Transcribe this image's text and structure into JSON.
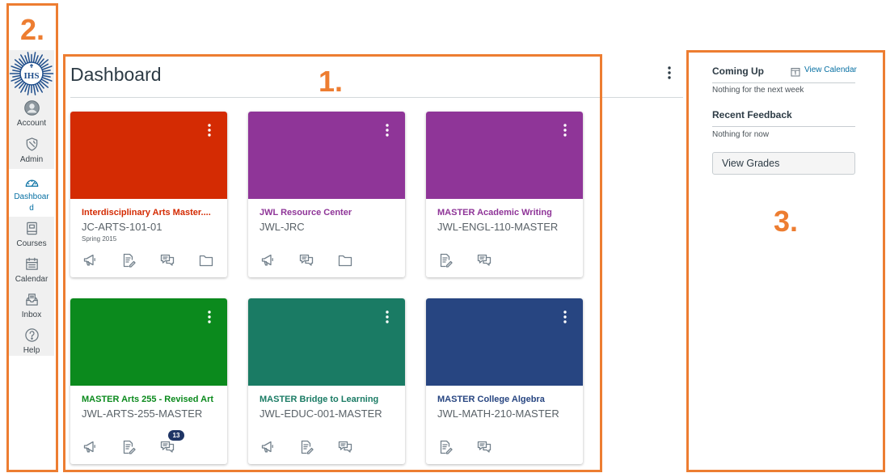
{
  "annotations": {
    "label_1": "1.",
    "label_2": "2.",
    "label_3": "3.",
    "color": "#ed7d31"
  },
  "colors": {
    "link": "#0770a3",
    "text": "#2d3b45",
    "logo": "#1f4e8c",
    "badge": "#1f3565"
  },
  "nav": {
    "logo_text": "IHS",
    "items": [
      {
        "label": "Account",
        "icon": "account-icon"
      },
      {
        "label": "Admin",
        "icon": "admin-icon"
      },
      {
        "label": "Dashboard",
        "icon": "dashboard-icon",
        "active": true
      },
      {
        "label": "Courses",
        "icon": "courses-icon"
      },
      {
        "label": "Calendar",
        "icon": "calendar-icon"
      },
      {
        "label": "Inbox",
        "icon": "inbox-icon"
      },
      {
        "label": "Help",
        "icon": "help-icon"
      }
    ]
  },
  "header": {
    "title": "Dashboard",
    "menu_icon": "more-options-icon"
  },
  "cards": [
    {
      "title": "Interdisciplinary Arts Master....",
      "code": "JC-ARTS-101-01",
      "term": "Spring 2015",
      "color": "#d42b03",
      "icons": [
        {
          "name": "announcements-icon"
        },
        {
          "name": "assignments-icon"
        },
        {
          "name": "discussions-icon"
        },
        {
          "name": "files-icon"
        }
      ]
    },
    {
      "title": "JWL Resource Center",
      "code": "JWL-JRC",
      "color": "#8f3598",
      "icons": [
        {
          "name": "announcements-icon"
        },
        {
          "name": "discussions-icon"
        },
        {
          "name": "files-icon"
        }
      ]
    },
    {
      "title": "MASTER Academic Writing",
      "code": "JWL-ENGL-110-MASTER",
      "color": "#8f3598",
      "icons": [
        {
          "name": "assignments-icon"
        },
        {
          "name": "discussions-icon"
        }
      ]
    },
    {
      "title": "MASTER Arts 255 - Revised Art",
      "code": "JWL-ARTS-255-MASTER",
      "color": "#0b8a1d",
      "icons": [
        {
          "name": "announcements-icon"
        },
        {
          "name": "assignments-icon"
        },
        {
          "name": "discussions-icon",
          "badge": "13"
        }
      ]
    },
    {
      "title": "MASTER Bridge to Learning",
      "code": "JWL-EDUC-001-MASTER",
      "color": "#1a7b64",
      "icons": [
        {
          "name": "announcements-icon"
        },
        {
          "name": "assignments-icon"
        },
        {
          "name": "discussions-icon"
        }
      ]
    },
    {
      "title": "MASTER College Algebra",
      "code": "JWL-MATH-210-MASTER",
      "color": "#274581",
      "icons": [
        {
          "name": "assignments-icon"
        },
        {
          "name": "discussions-icon"
        }
      ]
    }
  ],
  "right_sidebar": {
    "coming_up": {
      "title": "Coming Up",
      "view_calendar_label": "View Calendar",
      "empty_message": "Nothing for the next week"
    },
    "recent_feedback": {
      "title": "Recent Feedback",
      "empty_message": "Nothing for now"
    },
    "view_grades_label": "View Grades"
  }
}
